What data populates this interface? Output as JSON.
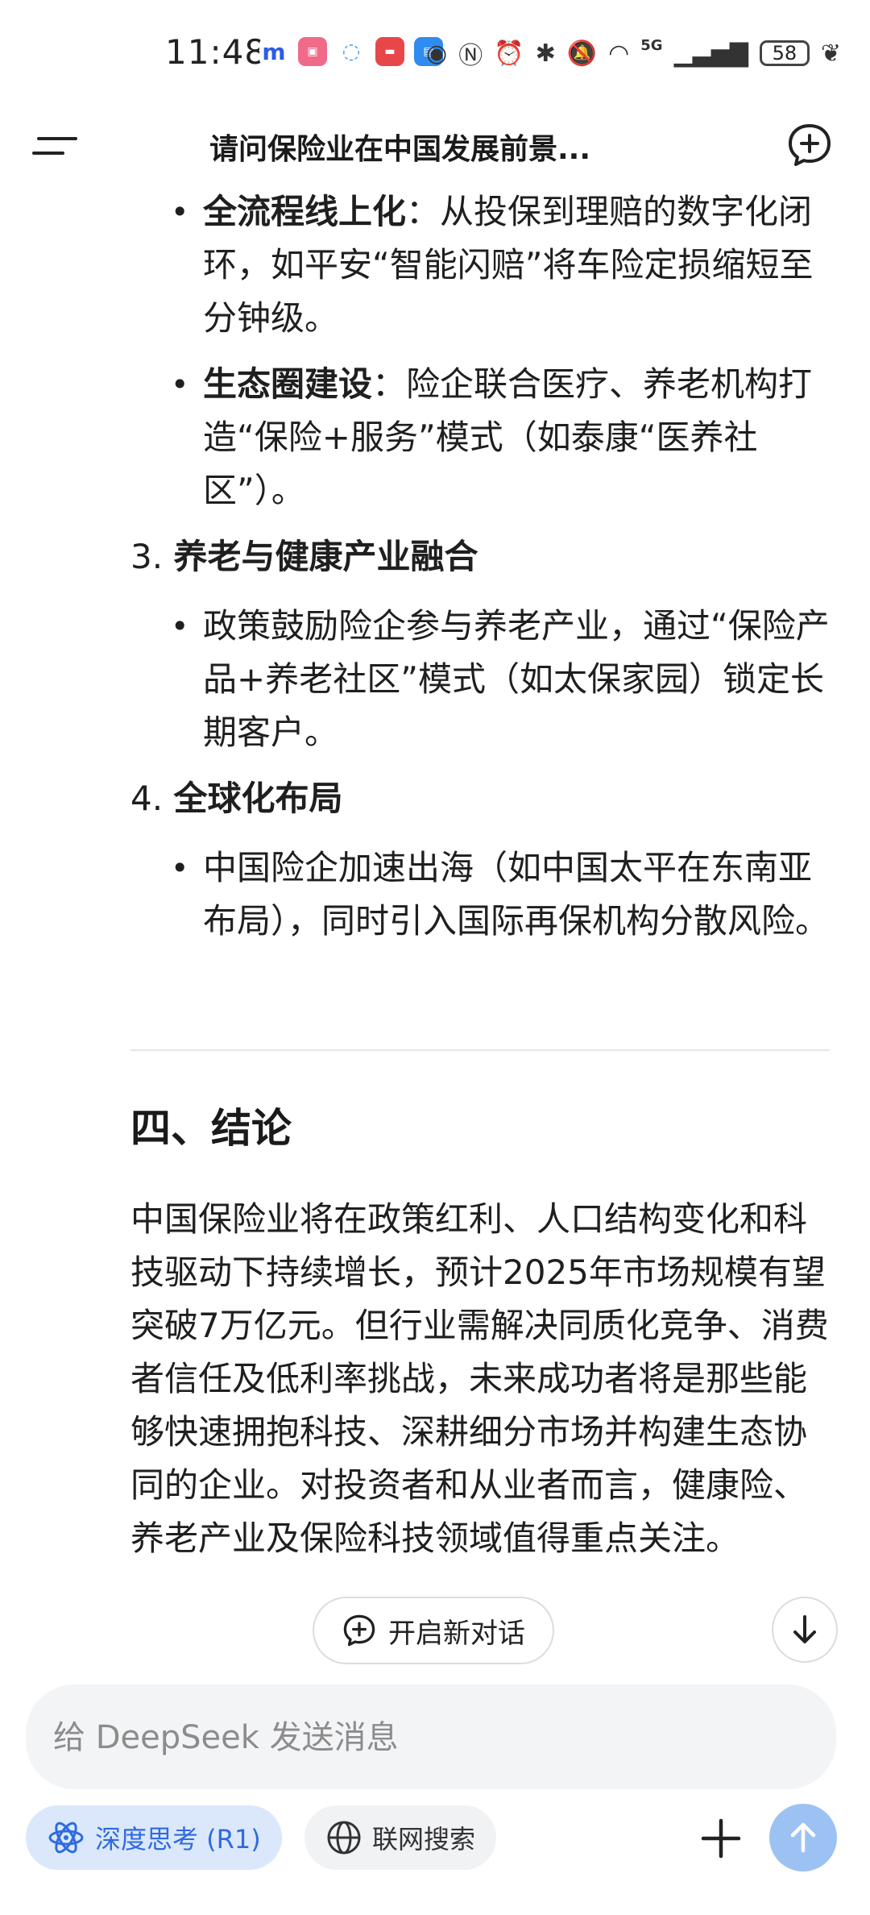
{
  "status_bar": {
    "time": "11:48",
    "network": "5G",
    "battery": "58"
  },
  "header": {
    "title": "请问保险业在中国发展前景..."
  },
  "content": {
    "bullets_top": [
      {
        "bold": "全流程线上化",
        "rest": "：从投保到理赔的数字化闭环，如平安“智能闪赔”将车险定损缩短至分钟级。"
      },
      {
        "bold": "生态圈建设",
        "rest": "：险企联合医疗、养老机构打造“保险+服务”模式（如泰康“医养社区”）。"
      }
    ],
    "item3": {
      "num": "3.",
      "title": "养老与健康产业融合"
    },
    "item3_bullet": "政策鼓励险企参与养老产业，通过“保险产品+养老社区”模式（如太保家园）锁定长期客户。",
    "item4": {
      "num": "4.",
      "title": "全球化布局"
    },
    "item4_bullet": "中国险企加速出海（如中国太平在东南亚布局），同时引入国际再保机构分散风险。",
    "section_title": "四、结论",
    "conclusion": "中国保险业将在政策红利、人口结构变化和科技驱动下持续增长，预计2025年市场规模有望突破7万亿元。但行业需解决同质化竞争、消费者信任及低利率挑战，未来成功者将是那些能够快速拥抱科技、深耕细分市场并构建生态协同的企业。对投资者和从业者而言，健康险、养老产业及保险科技领域值得重点关注。"
  },
  "floating": {
    "new_chat_label": "开启新对话"
  },
  "input": {
    "placeholder": "给 DeepSeek 发送消息"
  },
  "toolbar": {
    "deep_think_label": "深度思考 (R1)",
    "web_search_label": "联网搜索"
  },
  "colors": {
    "accent": "#2f6ae0",
    "chip_active_bg": "#dbe8fb",
    "send_disabled": "#9cc2f4"
  }
}
